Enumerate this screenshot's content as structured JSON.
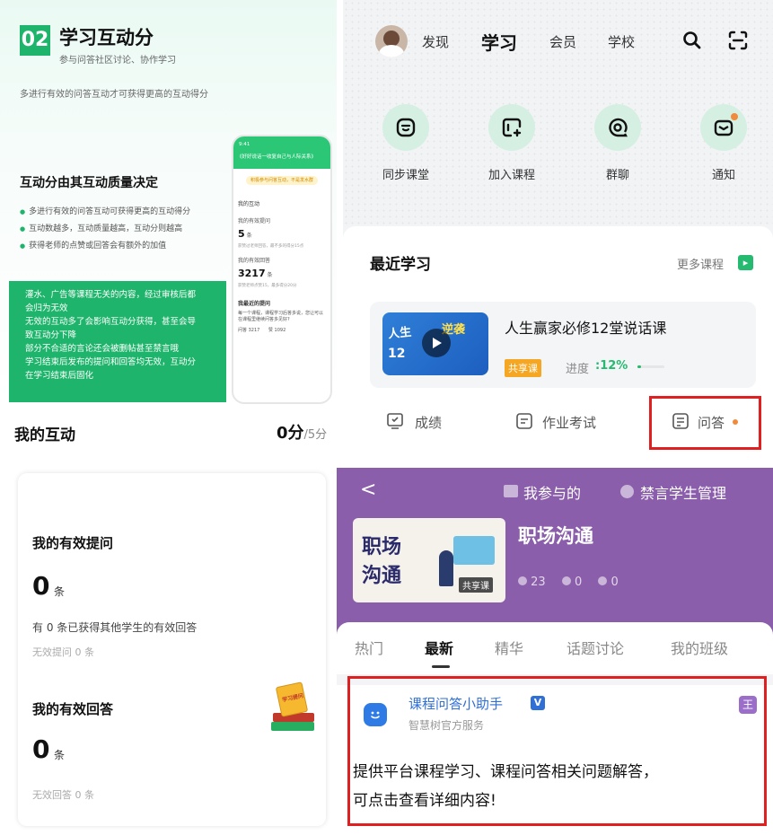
{
  "q1": {
    "number": "02",
    "title": "学习互动分",
    "subtitle": "参与问答社区讨论、协作学习",
    "description": "多进行有效的问答互动才可获得更高的互动得分",
    "heading": "互动分由其互动质量决定",
    "bullets": [
      "多进行有效的问答互动可获得更高的互动得分",
      "互动数越多，互动质量越高，互动分则越高",
      "获得老师的点赞或回答会有额外的加值"
    ],
    "warning_lines": [
      "灌水、广告等课程无关的内容，经过审核后都",
      "会归为无效",
      "无效的互动多了会影响互动分获得，甚至会导",
      "致互动分下降",
      "部分不合适的言论还会被删帖甚至禁言哦",
      "学习结束后发布的提问和回答均无效，互动分",
      "在学习结束后固化"
    ],
    "phone": {
      "time": "9:41",
      "header": "《好好说话一收复自己与人际关系》",
      "pill": "积极参与问答互动，不是发水群",
      "section": "我的互动",
      "q_label": "我的有效提问",
      "q_value": "5",
      "q_unit": "条",
      "q_note": "获赞过老师回答，最不多的得分15点",
      "a_label": "我的有效回答",
      "a_value": "3217",
      "a_unit": "条",
      "a_note": "获赞老师点赞15，最多得分20分",
      "hot_label": "我最近的提问",
      "hot_text": "每一个课程，课程学习后答多说，您让可以在课程里继续问答多见好?",
      "stat1_label": "问答",
      "stat1_value": "3217",
      "stat2_label": "赞",
      "stat2_value": "1092"
    }
  },
  "q2": {
    "nav": [
      "发现",
      "学习",
      "会员",
      "学校"
    ],
    "quick": [
      "同步课堂",
      "加入课程",
      "群聊",
      "通知"
    ],
    "recent_title": "最近学习",
    "more_label": "更多课程",
    "course_title": "人生赢家必修12堂说话课",
    "thumb_text1": "人生",
    "thumb_text2": "12",
    "thumb_text3": "逆袭",
    "badge": "共享课",
    "progress_label": "进度",
    "progress_value": ":12%",
    "progress": 0.12,
    "tabs": [
      "成绩",
      "作业考试",
      "问答"
    ]
  },
  "q3": {
    "section_title": "我的互动",
    "score": "0分",
    "score_total": "/5分",
    "q_title": "我的有效提问",
    "q_count": "0",
    "q_unit": "条",
    "q_note": "有 0 条已获得其他学生的有效回答",
    "q_invalid": "无效提问 0 条",
    "a_title": "我的有效回答",
    "a_count": "0",
    "a_unit": "条",
    "a_invalid": "无效回答 0 条",
    "illus_text": "学习提问"
  },
  "q4": {
    "back": "<",
    "participated": "我参与的",
    "mute": "禁言学生管理",
    "course_name": "职场沟通",
    "thumb_line1": "职场",
    "thumb_line2": "沟通",
    "thumb_badge": "共享课",
    "stats": [
      "23",
      "0",
      "0"
    ],
    "tabs": [
      "热门",
      "最新",
      "精华",
      "话题讨论",
      "我的班级"
    ],
    "active_tab": 1,
    "assistant_name": "课程问答小助手",
    "verified": "V",
    "assistant_sub": "智慧树官方服务",
    "corner_tag": "王",
    "post_line1": "提供平台课程学习、课程问答相关问题解答，",
    "post_line2": "可点击查看详细内容!"
  },
  "colors": {
    "green": "#1fb46b",
    "purple": "#8a5eaa",
    "highlight_red": "#e02020",
    "badge_orange": "#f5a623"
  }
}
